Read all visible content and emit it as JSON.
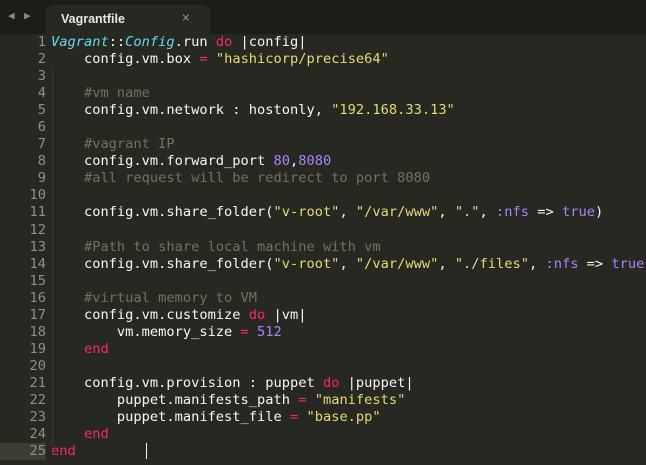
{
  "tab": {
    "title": "Vagrantfile",
    "close": "×",
    "back": "◀",
    "forward": "▶"
  },
  "colors": {
    "background": "#272822",
    "keyword": "#f92672",
    "string": "#e6db74",
    "number": "#ae81ff",
    "comment": "#75715e",
    "class": "#66d9ef"
  },
  "current_line": 25,
  "lines": [
    [
      [
        "cls",
        "Vagrant"
      ],
      [
        "p",
        "::"
      ],
      [
        "cls",
        "Config"
      ],
      [
        "p",
        ".run "
      ],
      [
        "kw",
        "do"
      ],
      [
        "p",
        " |config|"
      ]
    ],
    [
      [
        "p",
        "    config.vm.box "
      ],
      [
        "kw",
        "="
      ],
      [
        "p",
        " "
      ],
      [
        "str",
        "\"hashicorp/precise64\""
      ]
    ],
    [],
    [
      [
        "com",
        "    #vm name"
      ]
    ],
    [
      [
        "p",
        "    config.vm.network : hostonly, "
      ],
      [
        "str",
        "\"192.168.33.13\""
      ]
    ],
    [],
    [
      [
        "com",
        "    #vagrant IP"
      ]
    ],
    [
      [
        "p",
        "    config.vm.forward_port "
      ],
      [
        "num",
        "80"
      ],
      [
        "p",
        ","
      ],
      [
        "num",
        "8080"
      ]
    ],
    [
      [
        "com",
        "    #all request will be redirect to port 8080"
      ]
    ],
    [],
    [
      [
        "p",
        "    config.vm.share_folder("
      ],
      [
        "str",
        "\"v-root\""
      ],
      [
        "p",
        ", "
      ],
      [
        "str",
        "\"/var/www\""
      ],
      [
        "p",
        ", "
      ],
      [
        "str",
        "\".\""
      ],
      [
        "p",
        ", "
      ],
      [
        "sym",
        ":nfs"
      ],
      [
        "p",
        " => "
      ],
      [
        "num",
        "true"
      ],
      [
        "p",
        ")"
      ]
    ],
    [],
    [
      [
        "com",
        "    #Path to share local machine with vm"
      ]
    ],
    [
      [
        "p",
        "    config.vm.share_folder("
      ],
      [
        "str",
        "\"v-root\""
      ],
      [
        "p",
        ", "
      ],
      [
        "str",
        "\"/var/www\""
      ],
      [
        "p",
        ", "
      ],
      [
        "str",
        "\"./files\""
      ],
      [
        "p",
        ", "
      ],
      [
        "sym",
        ":nfs"
      ],
      [
        "p",
        " => "
      ],
      [
        "num",
        "true"
      ],
      [
        "p",
        ")"
      ]
    ],
    [],
    [
      [
        "com",
        "    #virtual memory to VM"
      ]
    ],
    [
      [
        "p",
        "    config.vm.customize "
      ],
      [
        "kw",
        "do"
      ],
      [
        "p",
        " |vm|"
      ]
    ],
    [
      [
        "p",
        "        vm.memory_size "
      ],
      [
        "kw",
        "="
      ],
      [
        "p",
        " "
      ],
      [
        "num",
        "512"
      ]
    ],
    [
      [
        "kw",
        "    end"
      ]
    ],
    [],
    [
      [
        "p",
        "    config.vm.provision : puppet "
      ],
      [
        "kw",
        "do"
      ],
      [
        "p",
        " |puppet|"
      ]
    ],
    [
      [
        "p",
        "        puppet.manifests_path "
      ],
      [
        "kw",
        "="
      ],
      [
        "p",
        " "
      ],
      [
        "str",
        "\"manifests\""
      ]
    ],
    [
      [
        "p",
        "        puppet.manifest_file "
      ],
      [
        "kw",
        "="
      ],
      [
        "p",
        " "
      ],
      [
        "str",
        "\"base.pp\""
      ]
    ],
    [
      [
        "kw",
        "    end"
      ]
    ],
    [
      [
        "kw",
        "end"
      ]
    ]
  ]
}
